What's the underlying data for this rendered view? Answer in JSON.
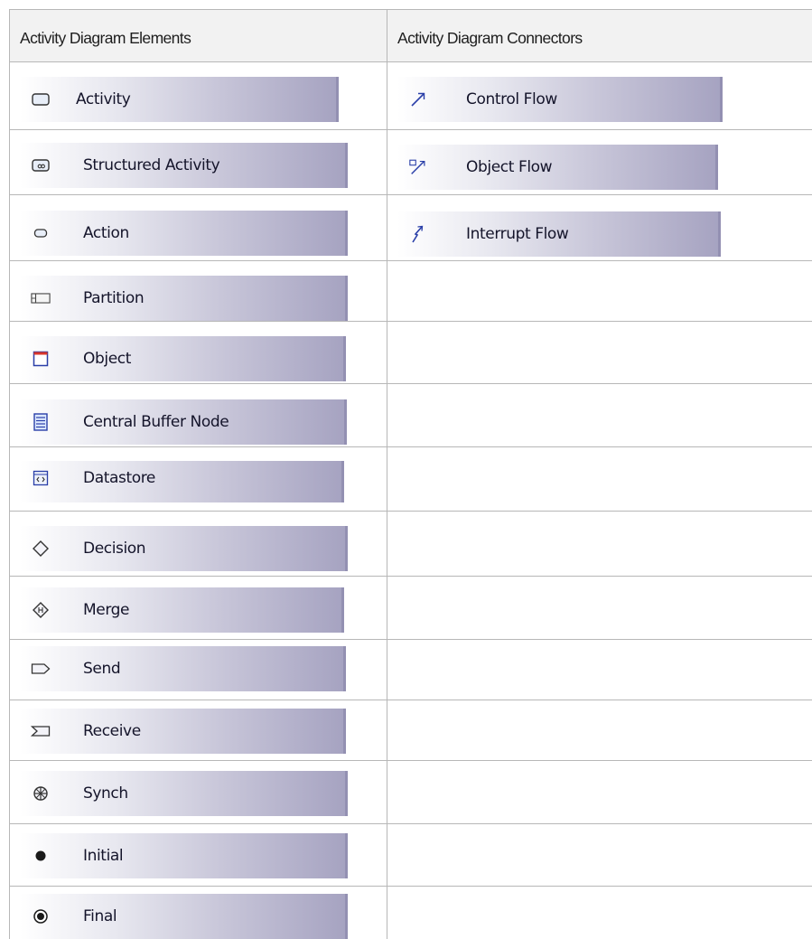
{
  "table": {
    "headers": [
      "Activity Diagram Elements",
      "Activity Diagram Connectors"
    ],
    "elements": [
      {
        "label": "Activity",
        "icon": "activity-icon"
      },
      {
        "label": "Structured Activity",
        "icon": "structured-activity-icon"
      },
      {
        "label": "Action",
        "icon": "action-icon"
      },
      {
        "label": "Partition",
        "icon": "partition-icon"
      },
      {
        "label": "Object",
        "icon": "object-icon"
      },
      {
        "label": "Central Buffer Node",
        "icon": "central-buffer-node-icon"
      },
      {
        "label": "Datastore",
        "icon": "datastore-icon"
      },
      {
        "label": "Decision",
        "icon": "decision-icon"
      },
      {
        "label": "Merge",
        "icon": "merge-icon"
      },
      {
        "label": "Send",
        "icon": "send-icon"
      },
      {
        "label": "Receive",
        "icon": "receive-icon"
      },
      {
        "label": "Synch",
        "icon": "synch-icon"
      },
      {
        "label": "Initial",
        "icon": "initial-icon"
      },
      {
        "label": "Final",
        "icon": "final-icon"
      }
    ],
    "connectors": [
      {
        "label": "Control Flow",
        "icon": "control-flow-icon"
      },
      {
        "label": "Object Flow",
        "icon": "object-flow-icon"
      },
      {
        "label": "Interrupt Flow",
        "icon": "interrupt-flow-icon"
      }
    ]
  },
  "colors": {
    "grid": "#b7b7b7",
    "header_bg": "#f2f2f2",
    "palette_gradient_end": "#a6a3c1",
    "icon_blue": "#2a3fa8"
  }
}
